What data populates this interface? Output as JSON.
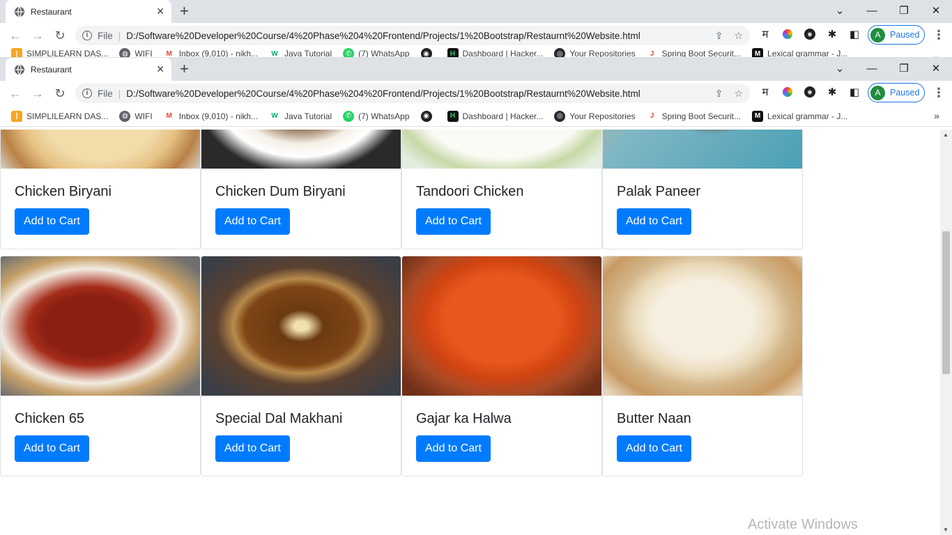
{
  "browser": {
    "tab_title": "Restaurant",
    "new_tab": "+",
    "url_scheme_label": "File",
    "url": "D:/Software%20Developer%20Course/4%20Phase%204%20Frontend/Projects/1%20Bootstrap/Restaurnt%20Website.html",
    "profile_initial": "A",
    "profile_status": "Paused",
    "ext_hindi": "म",
    "bookmarks": [
      {
        "label": "SIMPLILEARN DAS...",
        "icon": "simplilearn-icon"
      },
      {
        "label": "WIFI",
        "icon": "globe-icon"
      },
      {
        "label": "Inbox (9,010) - nikh...",
        "icon": "gmail-icon"
      },
      {
        "label": "Java Tutorial",
        "icon": "w3schools-icon"
      },
      {
        "label": "(7) WhatsApp",
        "icon": "whatsapp-icon"
      },
      {
        "label": "",
        "icon": "audio-icon"
      },
      {
        "label": "Dashboard | Hacker...",
        "icon": "hackerrank-icon"
      },
      {
        "label": "Your Repositories",
        "icon": "github-icon"
      },
      {
        "label": "Spring Boot Securit...",
        "icon": "javatpoint-icon"
      },
      {
        "label": "Lexical grammar - J...",
        "icon": "mdn-icon"
      }
    ]
  },
  "menu_items": [
    {
      "name": "Chicken Biryani",
      "button": "Add to Cart"
    },
    {
      "name": "Chicken Dum Biryani",
      "button": "Add to Cart"
    },
    {
      "name": "Tandoori Chicken",
      "button": "Add to Cart"
    },
    {
      "name": "Palak Paneer",
      "button": "Add to Cart"
    },
    {
      "name": "Chicken 65",
      "button": "Add to Cart"
    },
    {
      "name": "Special Dal Makhani",
      "button": "Add to Cart"
    },
    {
      "name": "Gajar ka Halwa",
      "button": "Add to Cart"
    },
    {
      "name": "Butter Naan",
      "button": "Add to Cart"
    }
  ],
  "watermark": "Activate Windows",
  "colors": {
    "primary_button": "#007bff",
    "profile_accent": "#1a73e8"
  }
}
